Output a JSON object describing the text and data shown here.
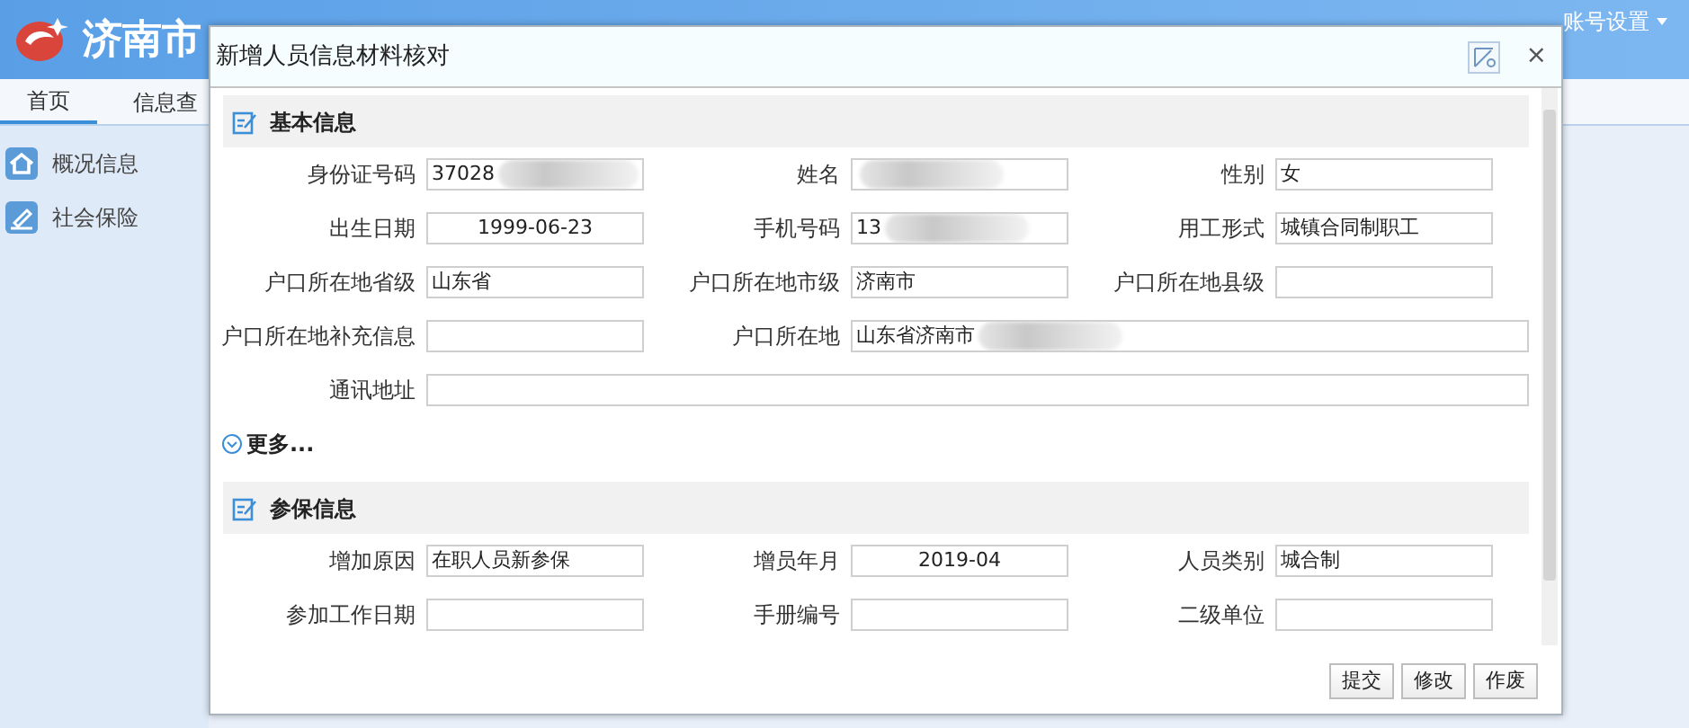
{
  "app": {
    "title": "济南市",
    "account": "账号设置",
    "nav": [
      {
        "label": "首页",
        "selected": true
      },
      {
        "label": "信息查",
        "selected": false
      }
    ],
    "sidebar": [
      {
        "label": "概况信息",
        "kind": "home"
      },
      {
        "label": "社会保险",
        "kind": "pen"
      }
    ]
  },
  "dialog": {
    "title": "新增人员信息材料核对",
    "close": "×",
    "sections": [
      {
        "title": "基本信息",
        "rows": [
          [
            {
              "label": "身份证号码",
              "value": "37028",
              "kind": "text",
              "redacted": true
            },
            {
              "label": "姓名",
              "kind": "text",
              "redacted": true
            },
            {
              "label": "性别",
              "value": "女",
              "kind": "text"
            }
          ],
          [
            {
              "label": "出生日期",
              "value": "1999-06-23",
              "kind": "centered"
            },
            {
              "label": "手机号码",
              "value": "13",
              "kind": "text",
              "redacted": true
            },
            {
              "label": "用工形式",
              "value": "城镇合同制职工",
              "kind": "text"
            }
          ],
          [
            {
              "label": "户口所在地省级",
              "value": "山东省",
              "kind": "text"
            },
            {
              "label": "户口所在地市级",
              "value": "济南市",
              "kind": "text"
            },
            {
              "label": "户口所在地县级",
              "kind": "text"
            }
          ],
          [
            {
              "label": "户口所在地补充信息",
              "kind": "text"
            },
            {
              "label": "户口所在地",
              "value": "山东省济南市",
              "kind": "wide",
              "redacted": true
            }
          ],
          [
            {
              "label": "通讯地址",
              "kind": "wide"
            }
          ]
        ],
        "more": "更多..."
      },
      {
        "title": "参保信息",
        "rows": [
          [
            {
              "label": "增加原因",
              "value": "在职人员新参保",
              "kind": "text"
            },
            {
              "label": "增员年月",
              "value": "2019-04",
              "kind": "centered"
            },
            {
              "label": "人员类别",
              "value": "城合制",
              "kind": "text"
            }
          ],
          [
            {
              "label": "参加工作日期",
              "kind": "text"
            },
            {
              "label": "手册编号",
              "kind": "text"
            },
            {
              "label": "二级单位",
              "kind": "text"
            }
          ]
        ]
      }
    ],
    "buttons": [
      "提交",
      "修改",
      "作废"
    ]
  }
}
